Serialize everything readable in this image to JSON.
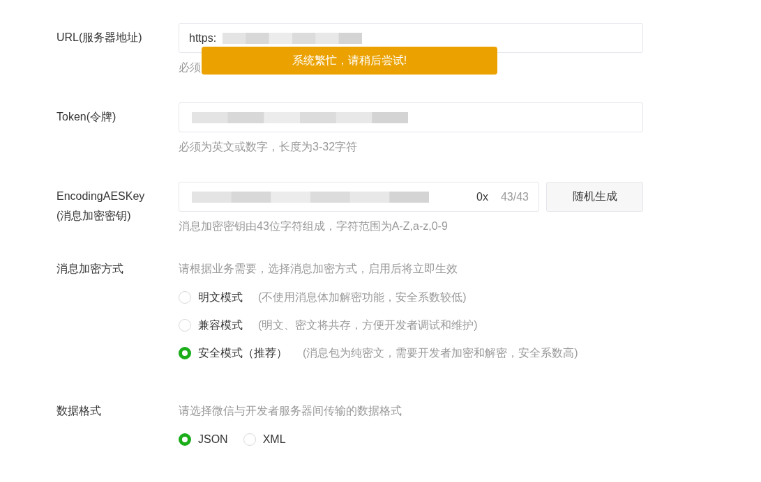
{
  "toast": {
    "text": "系统繁忙，请稍后尝试!"
  },
  "fields": [
    {
      "label": "URL(服务器地址)",
      "value": "https:",
      "redacted": true,
      "hint": "必须"
    },
    {
      "label": "Token(令牌)",
      "redacted": true,
      "hint": "必须为英文或数字，长度为3-32字符"
    },
    {
      "label": "EncodingAESKey (消息加密密钥)",
      "value": "0x",
      "redacted": true,
      "counter": "43/43",
      "button": "随机生成",
      "hint": "消息加密密钥由43位字符组成，字符范围为A-Z,a-z,0-9"
    }
  ],
  "sections": [
    {
      "label": "消息加密方式",
      "description": "请根据业务需要，选择消息加密方式，启用后将立即生效",
      "options": [
        {
          "label": "明文模式",
          "note": "(不使用消息体加解密功能，安全系数较低)",
          "selected": false
        },
        {
          "label": "兼容模式",
          "note": "(明文、密文将共存，方便开发者调试和维护)",
          "selected": false
        },
        {
          "label": "安全模式（推荐）",
          "note": "(消息包为纯密文，需要开发者加密和解密，安全系数高)",
          "selected": true
        }
      ]
    },
    {
      "label": "数据格式",
      "description": "请选择微信与开发者服务器间传输的数据格式",
      "options": [
        {
          "label": "JSON",
          "selected": true
        },
        {
          "label": "XML",
          "selected": false
        }
      ]
    }
  ]
}
